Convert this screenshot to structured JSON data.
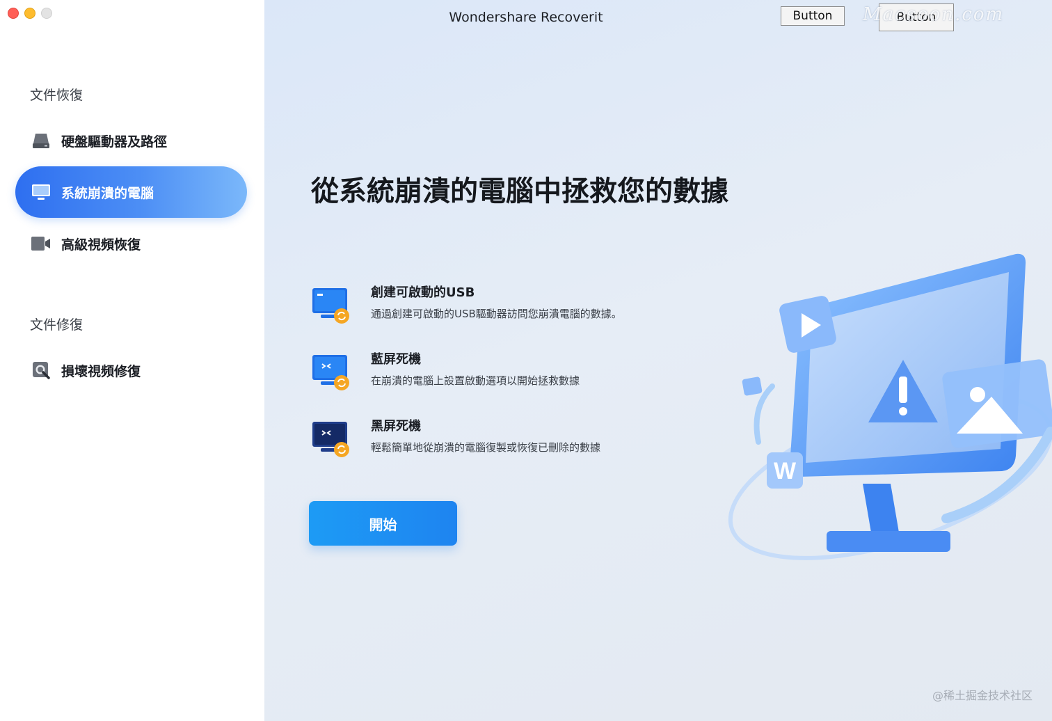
{
  "window": {
    "title": "Wondershare Recoverit",
    "buttons": [
      "Button",
      "Button"
    ],
    "watermark": "Macsoon.com"
  },
  "sidebar": {
    "sections": [
      {
        "title": "文件恢復",
        "items": [
          {
            "label": "硬盤驅動器及路徑",
            "icon": "hard-drive-icon",
            "active": false
          },
          {
            "label": "系統崩潰的電腦",
            "icon": "computer-icon",
            "active": true
          },
          {
            "label": "高級視頻恢復",
            "icon": "video-camera-icon",
            "active": false
          }
        ]
      },
      {
        "title": "文件修復",
        "items": [
          {
            "label": "損壞視頻修復",
            "icon": "video-repair-icon",
            "active": false
          }
        ]
      }
    ]
  },
  "main": {
    "headline": "從系統崩潰的電腦中拯救您的數據",
    "features": [
      {
        "title": "創建可啟動的USB",
        "desc": "通過創建可啟動的USB驅動器訪問您崩潰電腦的數據。",
        "icon": "bootable-usb-icon"
      },
      {
        "title": "藍屏死機",
        "desc": "在崩潰的電腦上設置啟動選項以開始拯救數據",
        "icon": "blue-screen-icon"
      },
      {
        "title": "黑屏死機",
        "desc": "輕鬆簡單地從崩潰的電腦復製或恢復已刪除的數據",
        "icon": "black-screen-icon"
      }
    ],
    "start_label": "開始",
    "footer_credit": "@稀土掘金技术社区"
  },
  "colors": {
    "accent": "#1e84f0",
    "active_nav_start": "#2e6ff0",
    "active_nav_end": "#7bb8fa",
    "main_bg": "#e2eaf5"
  }
}
